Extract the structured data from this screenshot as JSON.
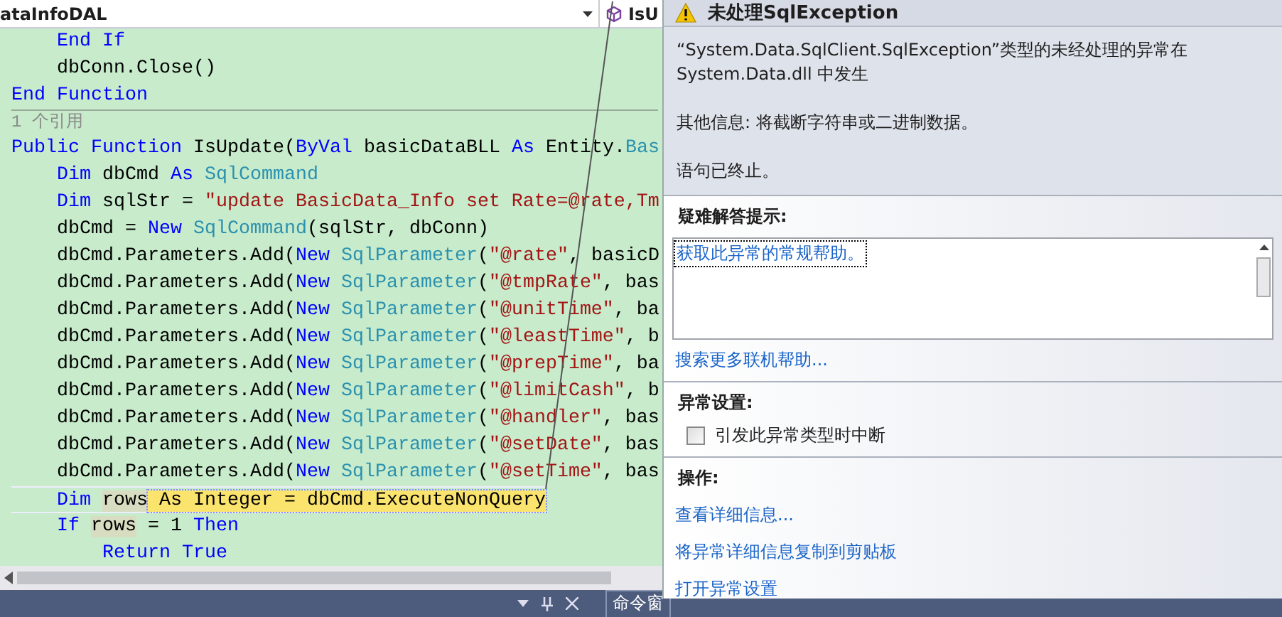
{
  "editor": {
    "class_dropdown": "ataInfoDAL",
    "member_dropdown": "IsU",
    "lines": [
      {
        "tokens": [
          {
            "kind": "keyword",
            "text": "    End If"
          }
        ]
      },
      {
        "tokens": [
          {
            "kind": "plain",
            "text": "    dbConn.Close()"
          }
        ]
      },
      {
        "tokens": [
          {
            "kind": "keyword",
            "text": "End Function"
          }
        ]
      },
      {
        "kind": "codelens",
        "tokens": [
          {
            "kind": "plain",
            "text": "1 个引用"
          }
        ]
      },
      {
        "tokens": [
          {
            "kind": "keyword",
            "text": "Public Function"
          },
          {
            "kind": "plain",
            "text": " IsUpdate("
          },
          {
            "kind": "keyword",
            "text": "ByVal"
          },
          {
            "kind": "plain",
            "text": " basicDataBLL "
          },
          {
            "kind": "keyword",
            "text": "As"
          },
          {
            "kind": "plain",
            "text": " Entity."
          },
          {
            "kind": "type",
            "text": "Bas"
          }
        ]
      },
      {
        "tokens": [
          {
            "kind": "keyword",
            "text": "    Dim"
          },
          {
            "kind": "plain",
            "text": " dbCmd "
          },
          {
            "kind": "keyword",
            "text": "As"
          },
          {
            "kind": "type",
            "text": " SqlCommand"
          }
        ]
      },
      {
        "tokens": [
          {
            "kind": "keyword",
            "text": "    Dim"
          },
          {
            "kind": "plain",
            "text": " sqlStr = "
          },
          {
            "kind": "string",
            "text": "\"update BasicData_Info set Rate=@rate,Tm"
          }
        ]
      },
      {
        "tokens": [
          {
            "kind": "plain",
            "text": "    dbCmd = "
          },
          {
            "kind": "keyword",
            "text": "New"
          },
          {
            "kind": "type",
            "text": " SqlCommand"
          },
          {
            "kind": "plain",
            "text": "(sqlStr, dbConn)"
          }
        ]
      },
      {
        "tokens": [
          {
            "kind": "plain",
            "text": "    dbCmd.Parameters.Add("
          },
          {
            "kind": "keyword",
            "text": "New"
          },
          {
            "kind": "type",
            "text": " SqlParameter"
          },
          {
            "kind": "plain",
            "text": "("
          },
          {
            "kind": "string",
            "text": "\"@rate\""
          },
          {
            "kind": "plain",
            "text": ", basicD"
          }
        ]
      },
      {
        "tokens": [
          {
            "kind": "plain",
            "text": "    dbCmd.Parameters.Add("
          },
          {
            "kind": "keyword",
            "text": "New"
          },
          {
            "kind": "type",
            "text": " SqlParameter"
          },
          {
            "kind": "plain",
            "text": "("
          },
          {
            "kind": "string",
            "text": "\"@tmpRate\""
          },
          {
            "kind": "plain",
            "text": ", bas"
          }
        ]
      },
      {
        "tokens": [
          {
            "kind": "plain",
            "text": "    dbCmd.Parameters.Add("
          },
          {
            "kind": "keyword",
            "text": "New"
          },
          {
            "kind": "type",
            "text": " SqlParameter"
          },
          {
            "kind": "plain",
            "text": "("
          },
          {
            "kind": "string",
            "text": "\"@unitTime\""
          },
          {
            "kind": "plain",
            "text": ", ba"
          }
        ]
      },
      {
        "tokens": [
          {
            "kind": "plain",
            "text": "    dbCmd.Parameters.Add("
          },
          {
            "kind": "keyword",
            "text": "New"
          },
          {
            "kind": "type",
            "text": " SqlParameter"
          },
          {
            "kind": "plain",
            "text": "("
          },
          {
            "kind": "string",
            "text": "\"@leastTime\""
          },
          {
            "kind": "plain",
            "text": ", b"
          }
        ]
      },
      {
        "tokens": [
          {
            "kind": "plain",
            "text": "    dbCmd.Parameters.Add("
          },
          {
            "kind": "keyword",
            "text": "New"
          },
          {
            "kind": "type",
            "text": " SqlParameter"
          },
          {
            "kind": "plain",
            "text": "("
          },
          {
            "kind": "string",
            "text": "\"@prepTime\""
          },
          {
            "kind": "plain",
            "text": ", ba"
          }
        ]
      },
      {
        "tokens": [
          {
            "kind": "plain",
            "text": "    dbCmd.Parameters.Add("
          },
          {
            "kind": "keyword",
            "text": "New"
          },
          {
            "kind": "type",
            "text": " SqlParameter"
          },
          {
            "kind": "plain",
            "text": "("
          },
          {
            "kind": "string",
            "text": "\"@limitCash\""
          },
          {
            "kind": "plain",
            "text": ", b"
          }
        ]
      },
      {
        "tokens": [
          {
            "kind": "plain",
            "text": "    dbCmd.Parameters.Add("
          },
          {
            "kind": "keyword",
            "text": "New"
          },
          {
            "kind": "type",
            "text": " SqlParameter"
          },
          {
            "kind": "plain",
            "text": "("
          },
          {
            "kind": "string",
            "text": "\"@handler\""
          },
          {
            "kind": "plain",
            "text": ", bas"
          }
        ]
      },
      {
        "tokens": [
          {
            "kind": "plain",
            "text": "    dbCmd.Parameters.Add("
          },
          {
            "kind": "keyword",
            "text": "New"
          },
          {
            "kind": "type",
            "text": " SqlParameter"
          },
          {
            "kind": "plain",
            "text": "("
          },
          {
            "kind": "string",
            "text": "\"@setDate\""
          },
          {
            "kind": "plain",
            "text": ", bas"
          }
        ]
      },
      {
        "tokens": [
          {
            "kind": "plain",
            "text": "    dbCmd.Parameters.Add("
          },
          {
            "kind": "keyword",
            "text": "New"
          },
          {
            "kind": "type",
            "text": " SqlParameter"
          },
          {
            "kind": "plain",
            "text": "("
          },
          {
            "kind": "string",
            "text": "\"@setTime\""
          },
          {
            "kind": "plain",
            "text": ", bas"
          }
        ]
      },
      {
        "tokens": [
          {
            "kind": "keyword",
            "text": "    Dim"
          },
          {
            "kind": "reference",
            "text": " rows"
          },
          {
            "kind": "highlight",
            "text": " As Integer = dbCmd.ExecuteNonQuery"
          }
        ]
      },
      {
        "tokens": [
          {
            "kind": "keyword",
            "text": "    If"
          },
          {
            "kind": "reference",
            "text": " rows"
          },
          {
            "kind": "plain",
            "text": " = 1 "
          },
          {
            "kind": "keyword",
            "text": "Then"
          }
        ]
      },
      {
        "tokens": [
          {
            "kind": "keyword",
            "text": "        Return True"
          }
        ]
      }
    ]
  },
  "bottom_bar": {
    "tab": "命令窗"
  },
  "popup": {
    "title": "未处理SqlException",
    "messages": [
      "“System.Data.SqlClient.SqlException”类型的未经处理的异常在 System.Data.dll 中发生",
      "其他信息: 将截断字符串或二进制数据。",
      "语句已终止。"
    ],
    "troubleshooting": {
      "heading": "疑难解答提示:",
      "tips": [
        {
          "text": "获取此异常的常规帮助。",
          "focused": true
        }
      ],
      "more_link": "搜索更多联机帮助..."
    },
    "settings": {
      "heading": "异常设置:",
      "options": [
        {
          "label": "引发此异常类型时中断",
          "checked": false
        }
      ]
    },
    "actions": {
      "heading": "操作:",
      "links": [
        "查看详细信息...",
        "将异常详细信息复制到剪贴板",
        "打开异常设置"
      ]
    }
  }
}
